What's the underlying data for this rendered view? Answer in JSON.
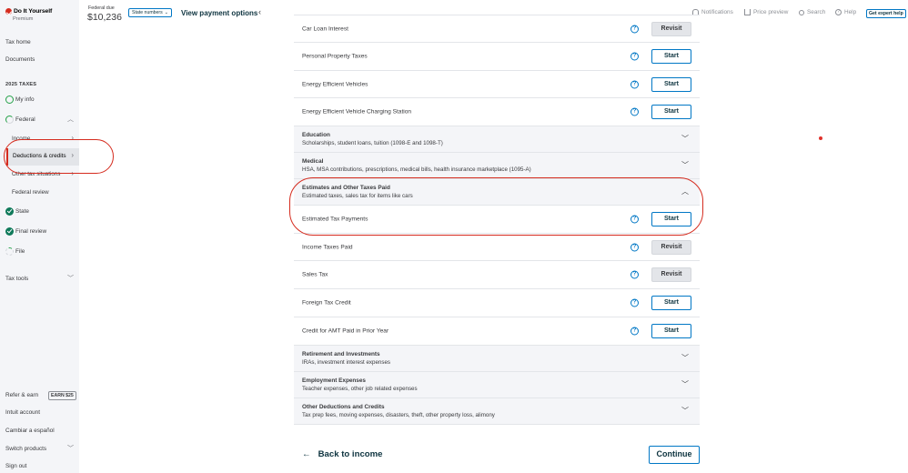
{
  "brand": {
    "title": "Do It Yourself",
    "subtitle": "Premium"
  },
  "sidebar": {
    "tax_home": "Tax home",
    "documents": "Documents",
    "section": "2025 TAXES",
    "my_info": "My info",
    "federal": "Federal",
    "income": "Income",
    "deductions": "Deductions & credits",
    "other_tax": "Other tax situations",
    "federal_review": "Federal review",
    "state": "State",
    "final_review": "Final review",
    "file": "File",
    "tax_tools": "Tax tools",
    "refer": "Refer & earn",
    "earn_badge": "EARN $25",
    "intuit_account": "Intuit account",
    "spanish": "Cambiar a español",
    "switch_products": "Switch products",
    "sign_out": "Sign out"
  },
  "header": {
    "federal_due_label": "Federal due",
    "federal_due_amount": "$10,236",
    "state_numbers": "State numbers",
    "view_payment": "View payment options",
    "notifications": "Notifications",
    "price_preview": "Price preview",
    "search": "Search",
    "help": "Help",
    "expert_help": "Get expert help"
  },
  "list": {
    "items": [
      {
        "title": "Car Loan Interest",
        "action": "Revisit"
      },
      {
        "title": "Personal Property Taxes",
        "action": "Start"
      },
      {
        "title": "Energy Efficient Vehicles",
        "action": "Start"
      },
      {
        "title": "Energy Efficient Vehicle Charging Station",
        "action": "Start"
      }
    ],
    "categories": [
      {
        "title": "Education",
        "desc": "Scholarships, student loans, tuition (1098-E and 1098-T)"
      },
      {
        "title": "Medical",
        "desc": "HSA, MSA contributions, prescriptions, medical bills, health insurance marketplace (1095-A)"
      },
      {
        "title": "Estimates and Other Taxes Paid",
        "desc": "Estimated taxes, sales tax for items like cars"
      }
    ],
    "estimates_items": [
      {
        "title": "Estimated Tax Payments",
        "action": "Start"
      },
      {
        "title": "Income Taxes Paid",
        "action": "Revisit"
      },
      {
        "title": "Sales Tax",
        "action": "Revisit"
      },
      {
        "title": "Foreign Tax Credit",
        "action": "Start"
      },
      {
        "title": "Credit for AMT Paid in Prior Year",
        "action": "Start"
      }
    ],
    "more_categories": [
      {
        "title": "Retirement and Investments",
        "desc": "IRAs, investment interest expenses"
      },
      {
        "title": "Employment Expenses",
        "desc": "Teacher expenses, other job related expenses"
      },
      {
        "title": "Other Deductions and Credits",
        "desc": "Tax prep fees, moving expenses, disasters, theft, other property loss, alimony"
      }
    ]
  },
  "footer": {
    "back": "Back to income",
    "continue": "Continue"
  },
  "colors": {
    "accent": "#0077c5",
    "brand_red": "#d52b1e",
    "annotation": "#d52b1e"
  }
}
